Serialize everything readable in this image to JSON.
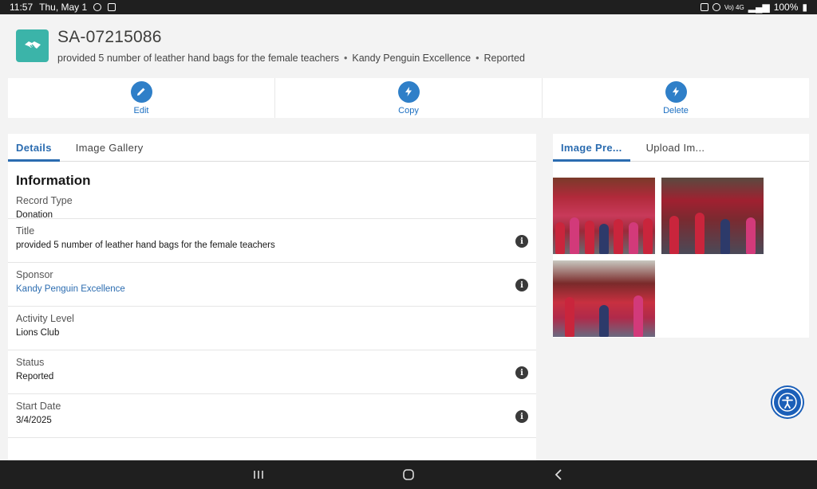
{
  "status_bar": {
    "time": "11:57",
    "date": "Thu, May 1",
    "signal_label": "Vo) 4G",
    "battery": "100%"
  },
  "record": {
    "id": "SA-07215086",
    "description": "provided 5 number of leather hand bags for the female teachers",
    "sponsor": "Kandy Penguin Excellence",
    "status": "Reported",
    "icon": "handshake-icon"
  },
  "actions": [
    {
      "label": "Edit",
      "icon": "pencil-icon"
    },
    {
      "label": "Copy",
      "icon": "lightning-icon"
    },
    {
      "label": "Delete",
      "icon": "lightning-icon"
    }
  ],
  "left_tabs": [
    "Details",
    "Image Gallery"
  ],
  "section_title": "Information",
  "fields": [
    {
      "label": "Record Type",
      "value": "Donation"
    },
    {
      "label": "Title",
      "value": "provided 5 number of leather hand bags for the female teachers"
    },
    {
      "label": "Sponsor",
      "value": "Kandy Penguin Excellence"
    },
    {
      "label": "Activity Level",
      "value": "Lions Club"
    },
    {
      "label": "Status",
      "value": "Reported"
    },
    {
      "label": "Start Date",
      "value": "3/4/2025"
    }
  ],
  "right_tabs": [
    "Image Pre...",
    "Upload Im..."
  ],
  "colors": {
    "accent": "#2b6cb0",
    "record_icon_bg": "#3bb4a9",
    "action_circle": "#2f7fc8"
  }
}
